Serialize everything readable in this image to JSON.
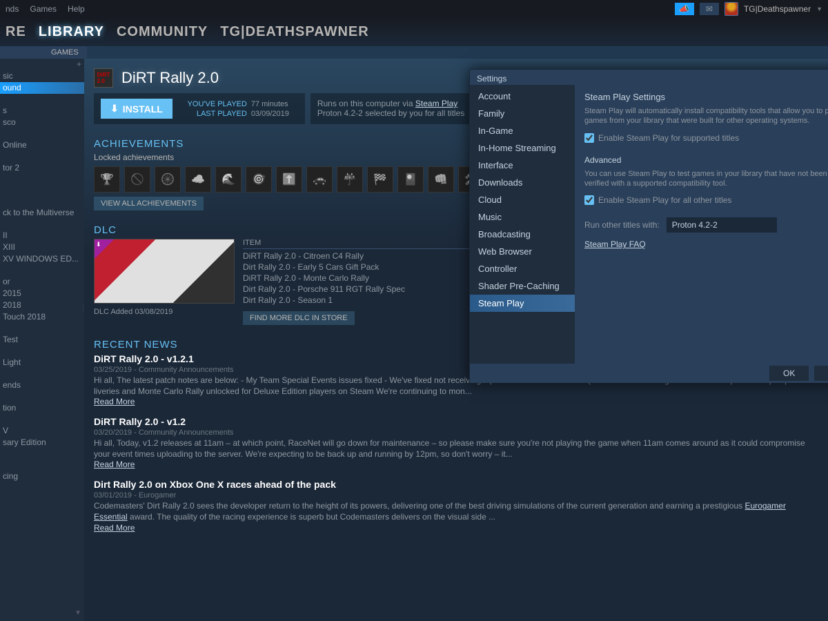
{
  "topmenu": {
    "friends": "nds",
    "games": "Games",
    "help": "Help"
  },
  "user": {
    "name": "TG|Deathspawner"
  },
  "nav": {
    "store": "RE",
    "library": "LIBRARY",
    "community": "COMMUNITY",
    "profile": "TG|DEATHSPAWNER"
  },
  "subnav": {
    "games": "GAMES"
  },
  "sidebar": [
    {
      "label": "sic",
      "type": "item"
    },
    {
      "label": "ound",
      "type": "selected"
    },
    {
      "label": "",
      "type": "spacer"
    },
    {
      "label": "s",
      "type": "item"
    },
    {
      "label": "sco",
      "type": "item"
    },
    {
      "label": "",
      "type": "spacer"
    },
    {
      "label": " Online",
      "type": "item"
    },
    {
      "label": "",
      "type": "spacer"
    },
    {
      "label": "tor 2",
      "type": "item"
    },
    {
      "label": "",
      "type": "spacer"
    },
    {
      "label": "",
      "type": "spacer"
    },
    {
      "label": "",
      "type": "spacer"
    },
    {
      "label": "ck to the Multiverse",
      "type": "item"
    },
    {
      "label": "",
      "type": "spacer"
    },
    {
      "label": "II",
      "type": "item"
    },
    {
      "label": "XIII",
      "type": "item"
    },
    {
      "label": "XV WINDOWS ED...",
      "type": "item"
    },
    {
      "label": "",
      "type": "spacer"
    },
    {
      "label": "or",
      "type": "item"
    },
    {
      "label": " 2015",
      "type": "item"
    },
    {
      "label": " 2018",
      "type": "item"
    },
    {
      "label": "Touch 2018",
      "type": "item"
    },
    {
      "label": "",
      "type": "spacer"
    },
    {
      "label": " Test",
      "type": "item"
    },
    {
      "label": "",
      "type": "spacer"
    },
    {
      "label": " Light",
      "type": "item"
    },
    {
      "label": "",
      "type": "spacer"
    },
    {
      "label": "ends",
      "type": "item"
    },
    {
      "label": "",
      "type": "spacer"
    },
    {
      "label": "tion",
      "type": "item"
    },
    {
      "label": "",
      "type": "spacer"
    },
    {
      "label": "V",
      "type": "item"
    },
    {
      "label": "sary Edition",
      "type": "item"
    },
    {
      "label": "",
      "type": "spacer"
    },
    {
      "label": "",
      "type": "spacer"
    },
    {
      "label": "cing",
      "type": "item"
    }
  ],
  "sidebar_collapsed_plus": "+",
  "game": {
    "title": "DiRT Rally 2.0",
    "install": "INSTALL",
    "played_label": "YOU'VE PLAYED",
    "played_val": "77 minutes",
    "last_label": "LAST PLAYED",
    "last_val": "03/09/2019",
    "runs": "Runs on this computer via ",
    "steamplay": "Steam Play",
    "proton": "Proton 4.2-2 selected by you for all titles"
  },
  "ach": {
    "title": "ACHIEVEMENTS",
    "locked": "Locked achievements",
    "viewall": "VIEW ALL ACHIEVEMENTS",
    "icons": [
      "🏆",
      "🚫",
      "🛞",
      "☁️",
      "🌊",
      "🎯",
      "⬆️",
      "🚗",
      "☔",
      "🏁",
      "🎴",
      "👊",
      "🛠️"
    ]
  },
  "dlc": {
    "title": "DLC",
    "item_header": "ITEM",
    "items": [
      "DiRT Rally 2.0 - Citroen C4 Rally",
      "Dirt Rally 2.0 - Early 5 Cars Gift Pack",
      "DiRT Rally 2.0 - Monte Carlo Rally",
      "Dirt Rally 2.0 - Porsche 911 RGT Rally Spec",
      "Dirt Rally 2.0 - Season 1"
    ],
    "added": "DLC Added 03/08/2019",
    "find": "FIND MORE DLC IN STORE"
  },
  "news": {
    "title": "RECENT NEWS",
    "items": [
      {
        "t": "DiRT Rally 2.0 - v1.2.1",
        "m": "03/25/2019 - Community Announcements",
        "b": "Hi all, The latest patch notes are below: - My Team Special Events issues fixed - We've fixed not receiving input from unofficial devices (without re-connecting the device after press start) - Special liveries and Monte Carlo Rally unlocked for Deluxe Edition players on Steam We're continuing to mon...",
        "r": "Read More"
      },
      {
        "t": "DiRT Rally 2.0 - v1.2",
        "m": "03/20/2019 - Community Announcements",
        "b": "Hi all, Today, v1.2 releases at 11am – at which point, RaceNet will go down for maintenance – so please make sure you're not playing the game when 11am comes around as it could compromise your event times uploading to the server. We're expecting to be back up and running by 12pm, so don't worry – it...",
        "r": "Read More"
      },
      {
        "t": "Dirt Rally 2.0 on Xbox One X races ahead of the pack",
        "m": "03/01/2019 - Eurogamer",
        "b": "Codemasters' Dirt Rally 2.0 sees the developer return to the height of its powers, delivering one of the best driving simulations of the current generation and earning a prestigious ",
        "link": "Eurogamer Essential",
        "b2": " award. The quality of the racing experience is superb but Codemasters delivers on the visual side ...",
        "r": "Read More"
      }
    ]
  },
  "settings": {
    "title": "Settings",
    "cats": [
      "Account",
      "Family",
      "In-Game",
      "In-Home Streaming",
      "Interface",
      "Downloads",
      "Cloud",
      "Music",
      "Broadcasting",
      "Web Browser",
      "Controller",
      "Shader Pre-Caching",
      "Steam Play"
    ],
    "pane": {
      "title": "Steam Play Settings",
      "desc": "Steam Play will automatically install compatibility tools that allow you to play games from your library that were built for other operating systems.",
      "cb1": "Enable Steam Play for supported titles",
      "adv": "Advanced",
      "advdesc": "You can use Steam Play to test games in your library that have not been verified with a supported compatibility tool.",
      "cb2": "Enable Steam Play for all other titles",
      "runlabel": "Run other titles with:",
      "runval": "Proton 4.2-2",
      "faq": "Steam Play FAQ"
    },
    "ok": "OK",
    "cancel": "C"
  }
}
